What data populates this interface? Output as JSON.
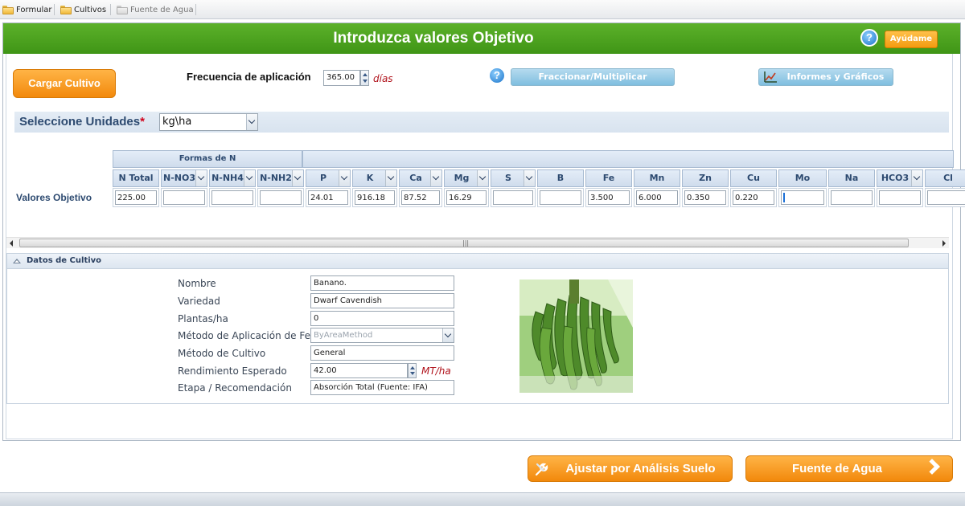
{
  "tabs": [
    {
      "label": "Formular",
      "icon": "folder-icon"
    },
    {
      "label": "Cultivos",
      "icon": "folder-icon"
    },
    {
      "label": "Fuente de Agua",
      "icon": "folder-icon"
    }
  ],
  "header": {
    "title": "Introduzca valores Objetivo",
    "help_label": "Ayúdame",
    "help_icon": "?"
  },
  "toolbar": {
    "load_crop": "Cargar Cultivo",
    "frequency_label": "Frecuencia de aplicación",
    "frequency_value": "365.00",
    "frequency_unit": "días",
    "split_help_icon": "?",
    "split_label": "Fraccionar/Multiplicar Aplicación",
    "reports_label": "Informes y Gráficos"
  },
  "units": {
    "label": "Seleccione Unidades",
    "required_mark": "*",
    "value": "kg\\ha"
  },
  "grid": {
    "group_label": "Formas de N",
    "row_label": "Valores Objetivo",
    "columns": [
      {
        "label": "N Total",
        "value": "225.00"
      },
      {
        "label": "N-NO3",
        "value": ""
      },
      {
        "label": "N-NH4",
        "value": ""
      },
      {
        "label": "N-NH2",
        "value": ""
      },
      {
        "label": "P",
        "value": "24.01"
      },
      {
        "label": "K",
        "value": "916.18"
      },
      {
        "label": "Ca",
        "value": "87.52"
      },
      {
        "label": "Mg",
        "value": "16.29"
      },
      {
        "label": "S",
        "value": ""
      },
      {
        "label": "B",
        "value": ""
      },
      {
        "label": "Fe",
        "value": "3.500"
      },
      {
        "label": "Mn",
        "value": "6.000"
      },
      {
        "label": "Zn",
        "value": "0.350"
      },
      {
        "label": "Cu",
        "value": "0.220"
      },
      {
        "label": "Mo",
        "value": ""
      },
      {
        "label": "Na",
        "value": ""
      },
      {
        "label": "HCO3",
        "value": ""
      },
      {
        "label": "Cl",
        "value": ""
      }
    ],
    "scroll_grip": "|||"
  },
  "crop": {
    "section_title": "Datos de Cultivo",
    "fields": {
      "name": {
        "label": "Nombre",
        "value": "Banano."
      },
      "variety": {
        "label": "Variedad",
        "value": "Dwarf Cavendish"
      },
      "plants": {
        "label": "Plantas/ha",
        "value": "0"
      },
      "method": {
        "label": "Método de Aplicación de Fert.",
        "value": "ByAreaMethod"
      },
      "cultivation": {
        "label": "Método de Cultivo",
        "value": "General"
      },
      "yield": {
        "label": "Rendimiento Esperado",
        "value": "42.00",
        "unit": "MT/ha"
      },
      "stage": {
        "label": "Etapa / Recomendación",
        "value": "Absorción Total (Fuente: IFA)"
      }
    }
  },
  "footer": {
    "soil_button": "Ajustar por Análisis Suelo",
    "water_button": "Fuente de Agua"
  }
}
